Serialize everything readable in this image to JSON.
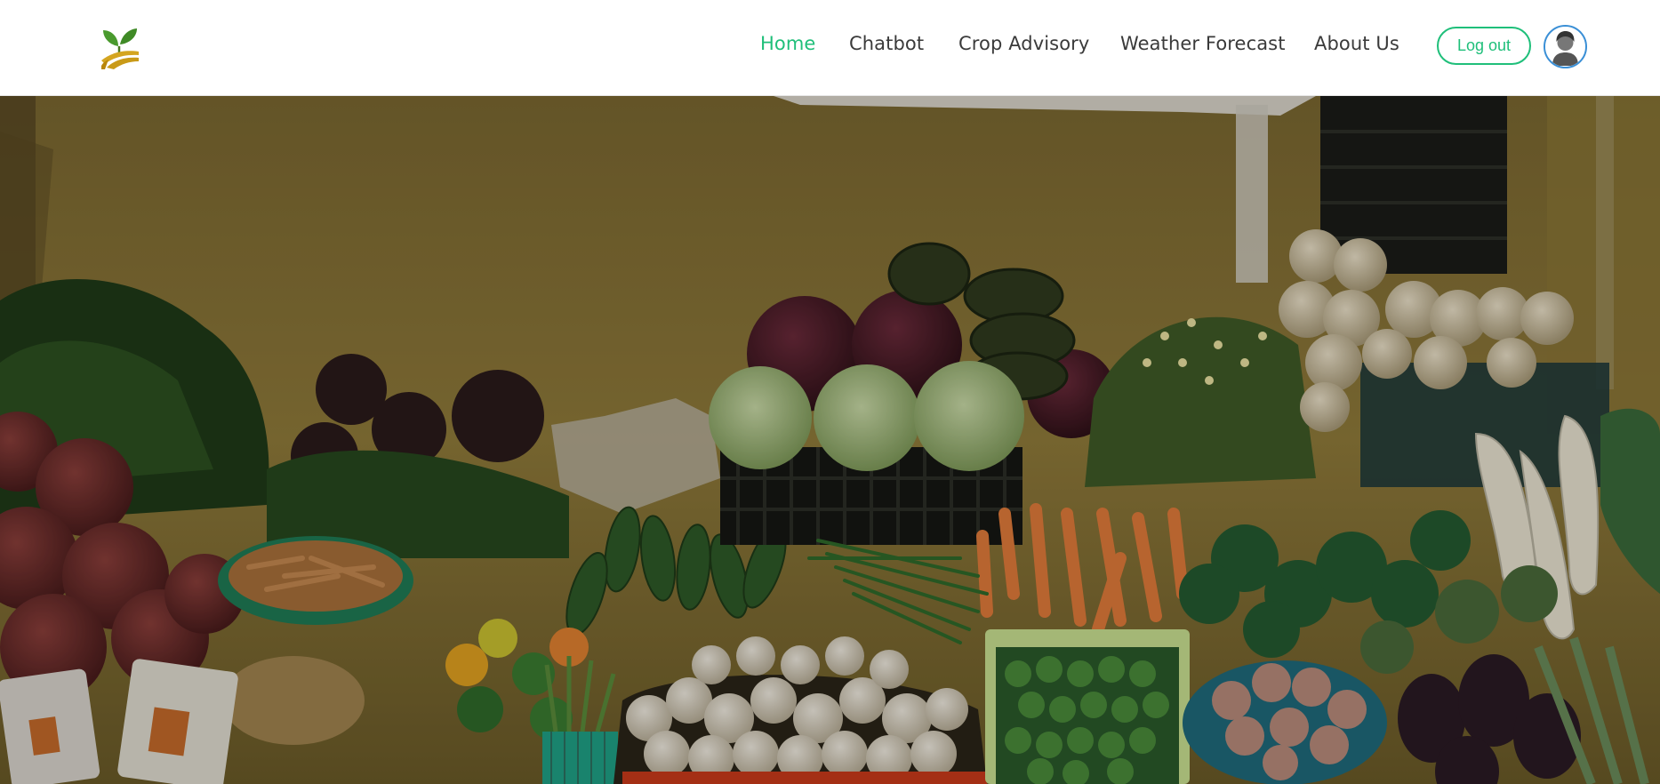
{
  "header": {
    "logo_icon": "sprout-logo-icon",
    "nav": [
      {
        "label": "Home",
        "active": true
      },
      {
        "label": "Chatbot",
        "active": false
      },
      {
        "label": "Crop Advisory",
        "active": false
      },
      {
        "label": "Weather Forecast",
        "active": false
      },
      {
        "label": "About Us",
        "active": false
      }
    ],
    "logout_label": "Log out",
    "avatar_icon": "user-avatar-icon",
    "accent_color": "#1fbf7a"
  },
  "hero": {
    "image": "vegetable-market-stall-photo"
  }
}
